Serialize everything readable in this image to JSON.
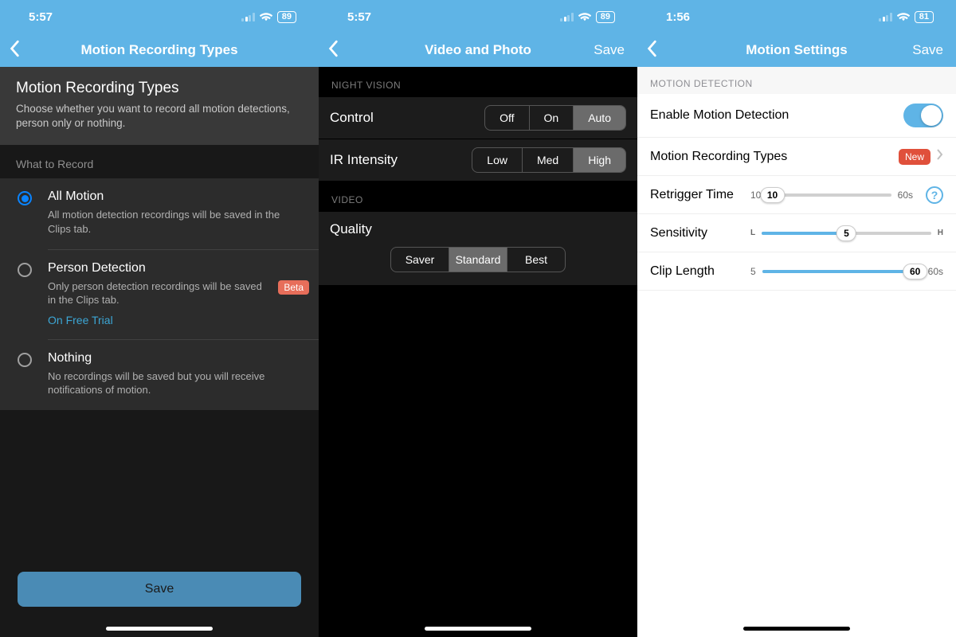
{
  "screen1": {
    "status": {
      "time": "5:57",
      "battery": "89"
    },
    "nav_title": "Motion Recording Types",
    "header_title": "Motion Recording Types",
    "header_desc": "Choose whether you want to record all motion detections, person only or nothing.",
    "section_label": "What to Record",
    "options": [
      {
        "title": "All Motion",
        "desc": "All motion detection recordings will be saved in the Clips tab.",
        "selected": true
      },
      {
        "title": "Person Detection",
        "desc": "Only person detection recordings will be saved in the Clips tab.",
        "selected": false,
        "badge": "Beta",
        "trial": "On Free Trial"
      },
      {
        "title": "Nothing",
        "desc": "No recordings will be saved but you will receive notifications of motion.",
        "selected": false
      }
    ],
    "save_label": "Save"
  },
  "screen2": {
    "status": {
      "time": "5:57",
      "battery": "89"
    },
    "nav_title": "Video and Photo",
    "nav_save": "Save",
    "nightvision_label": "NIGHT VISION",
    "control_label": "Control",
    "control_opts": [
      "Off",
      "On",
      "Auto"
    ],
    "control_sel": "Auto",
    "ir_label": "IR Intensity",
    "ir_opts": [
      "Low",
      "Med",
      "High"
    ],
    "ir_sel": "High",
    "video_label": "VIDEO",
    "quality_label": "Quality",
    "quality_opts": [
      "Saver",
      "Standard",
      "Best"
    ],
    "quality_sel": "Standard"
  },
  "screen3": {
    "status": {
      "time": "1:56",
      "battery": "81"
    },
    "nav_title": "Motion Settings",
    "nav_save": "Save",
    "section_label": "MOTION DETECTION",
    "enable_label": "Enable Motion Detection",
    "enable_on": true,
    "types_label": "Motion Recording Types",
    "types_badge": "New",
    "retrigger": {
      "label": "Retrigger Time",
      "min": "10",
      "max": "60s",
      "value": "10",
      "pct": 4
    },
    "sensitivity": {
      "label": "Sensitivity",
      "min": "L",
      "max": "H",
      "value": "5",
      "pct": 50
    },
    "clip": {
      "label": "Clip Length",
      "min": "5",
      "max": "60s",
      "value": "60",
      "pct": 96
    },
    "help": "?"
  }
}
